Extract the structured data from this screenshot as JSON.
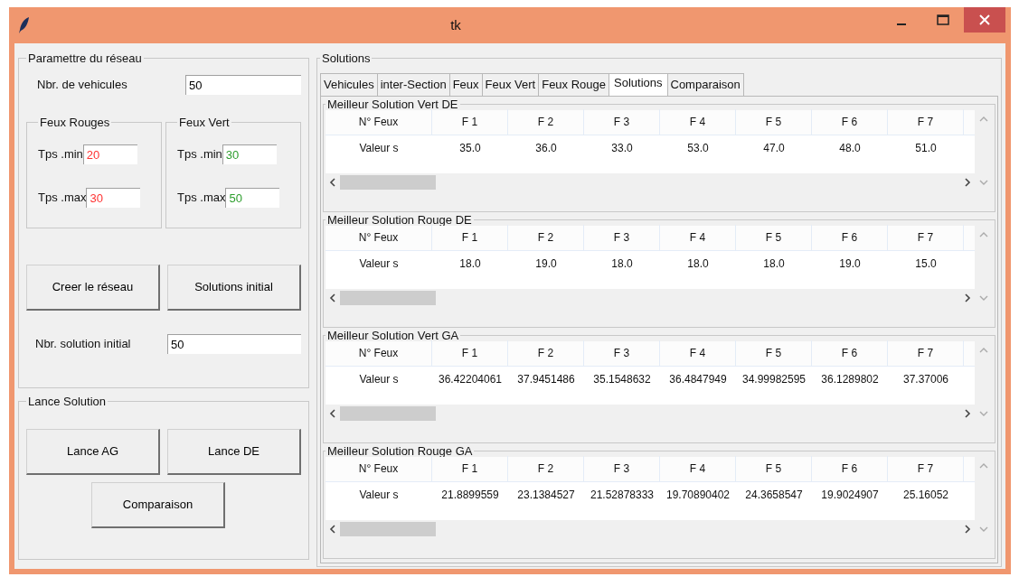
{
  "window": {
    "title": "tk"
  },
  "parameters": {
    "title": "Paramettre du réseau",
    "vehicles": {
      "label": "Nbr. de vehicules",
      "value": "50"
    },
    "light_groups": [
      {
        "title": "Feux Rouges",
        "fields": [
          {
            "label": "Tps .min",
            "value": "20",
            "color": "#ff3333"
          },
          {
            "label": "Tps .max",
            "value": "30",
            "color": "#ff3333"
          }
        ]
      },
      {
        "title": "Feux Vert",
        "fields": [
          {
            "label": "Tps .min",
            "value": "30",
            "color": "#2e9e2e"
          },
          {
            "label": "Tps .max",
            "value": "50",
            "color": "#2e9e2e"
          }
        ]
      }
    ],
    "buttons": [
      "Creer le réseau",
      "Solutions initial"
    ],
    "initial_solutions": {
      "label": "Nbr. solution initial",
      "value": "50"
    }
  },
  "launch": {
    "title": "Lance Solution",
    "buttons": [
      "Lance AG",
      "Lance DE"
    ],
    "compare_button": "Comparaison"
  },
  "solutions": {
    "title": "Solutions",
    "tabs": [
      {
        "label": "Vehicules",
        "selected": false
      },
      {
        "label": "inter-Section",
        "selected": false
      },
      {
        "label": "Feux",
        "selected": false
      },
      {
        "label": "Feux Vert",
        "selected": false
      },
      {
        "label": "Feux Rouge",
        "selected": false
      },
      {
        "label": "Solutions",
        "selected": true
      },
      {
        "label": "Comparaison",
        "selected": false
      }
    ],
    "tables": [
      {
        "title": "Meilleur Solution Vert DE",
        "header": "N° Feux",
        "columns": [
          "F 1",
          "F 2",
          "F 3",
          "F 4",
          "F 5",
          "F 6",
          "F 7"
        ],
        "row_label": "Valeur s",
        "values": [
          "35.0",
          "36.0",
          "33.0",
          "53.0",
          "47.0",
          "48.0",
          "51.0"
        ]
      },
      {
        "title": "Meilleur Solution Rouge DE",
        "header": "N° Feux",
        "columns": [
          "F 1",
          "F 2",
          "F 3",
          "F 4",
          "F 5",
          "F 6",
          "F 7"
        ],
        "row_label": "Valeur s",
        "values": [
          "18.0",
          "19.0",
          "18.0",
          "18.0",
          "18.0",
          "19.0",
          "15.0"
        ]
      },
      {
        "title": "Meilleur Solution Vert GA",
        "header": "N° Feux",
        "columns": [
          "F 1",
          "F 2",
          "F 3",
          "F 4",
          "F 5",
          "F 6",
          "F 7"
        ],
        "row_label": "Valeur s",
        "values": [
          "36.42204061",
          "37.9451486",
          "35.1548632",
          "36.4847949",
          "34.99982595",
          "36.1289802",
          "37.37006"
        ]
      },
      {
        "title": "Meilleur Solution Rouge GA",
        "header": "N° Feux",
        "columns": [
          "F 1",
          "F 2",
          "F 3",
          "F 4",
          "F 5",
          "F 6",
          "F 7"
        ],
        "row_label": "Valeur s",
        "values": [
          "21.8899559",
          "23.1384527",
          "21.52878333",
          "19.70890402",
          "24.3658547",
          "19.9024907",
          "25.16052"
        ]
      }
    ]
  }
}
